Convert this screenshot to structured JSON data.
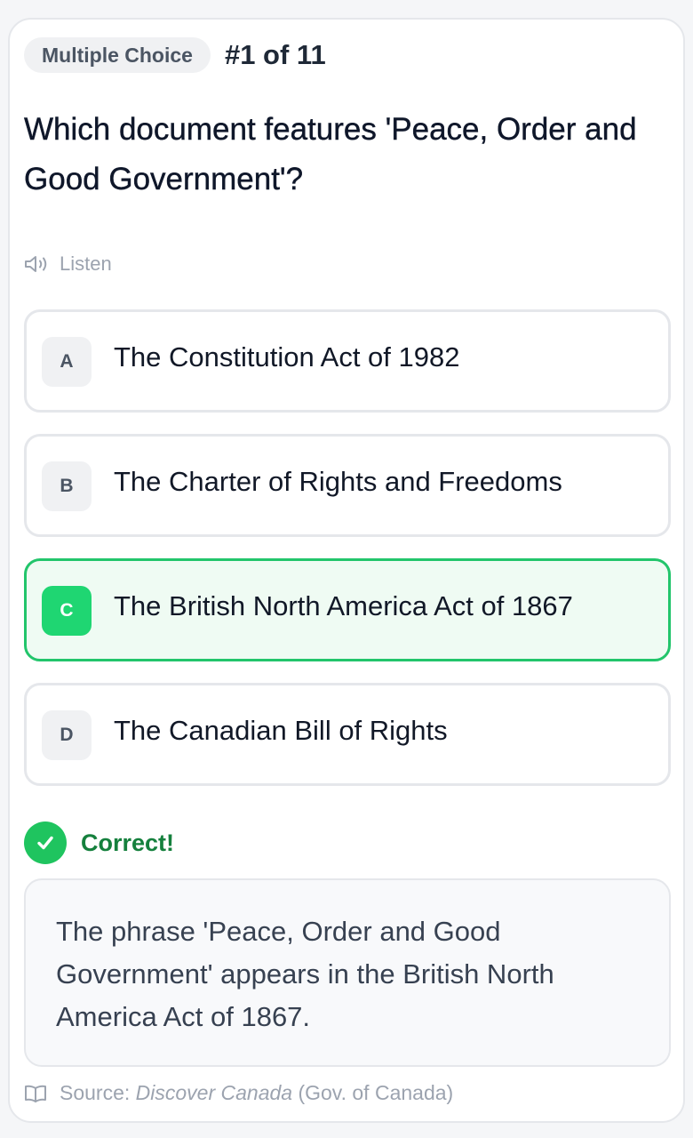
{
  "header": {
    "type_badge": "Multiple Choice",
    "counter": "#1 of 11"
  },
  "question": {
    "text": "Which document features 'Peace, Order and Good Government'?",
    "listen_label": "Listen"
  },
  "options": [
    {
      "letter": "A",
      "text": "The Constitution Act of 1982",
      "selected": false
    },
    {
      "letter": "B",
      "text": "The Charter of Rights and Freedoms",
      "selected": false
    },
    {
      "letter": "C",
      "text": "The British North America Act of 1867",
      "selected": true
    },
    {
      "letter": "D",
      "text": "The Canadian Bill of Rights",
      "selected": false
    }
  ],
  "result": {
    "label": "Correct!",
    "explanation": "The phrase 'Peace, Order and Good Government' appears in the British North America Act of 1867."
  },
  "source": {
    "prefix": "Source:",
    "title": "Discover Canada",
    "publisher": "(Gov. of Canada)"
  },
  "colors": {
    "accent_green": "#1fd672",
    "correct_text": "#15803d"
  },
  "icons": {
    "listen": "speaker-icon",
    "result": "check-circle-icon",
    "source": "book-icon"
  }
}
